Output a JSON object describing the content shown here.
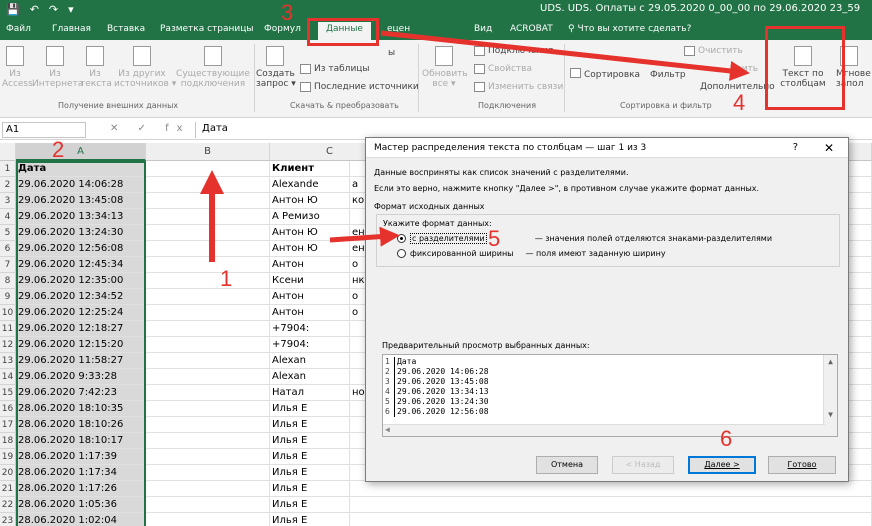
{
  "titlebar": {
    "quick_access": [
      "💾",
      "↶",
      "↷",
      "▾"
    ],
    "doc_title": "UDS. UDS. Оплаты с 29.05.2020 0_00_00 по 29.06.2020 23_59"
  },
  "tabs": [
    {
      "label": "Файл"
    },
    {
      "label": "Главная"
    },
    {
      "label": "Вставка"
    },
    {
      "label": "Разметка страницы"
    },
    {
      "label": "Формул"
    },
    {
      "label": "Данные"
    },
    {
      "label": "ецен"
    },
    {
      "label": "Вид"
    },
    {
      "label": "ACROBAT"
    }
  ],
  "tell_me": "Что вы хотите сделать?",
  "ribbon": {
    "external": {
      "b1": [
        "Из",
        "Access"
      ],
      "b2": [
        "Из",
        "Интернета"
      ],
      "b3": [
        "Из",
        "текста"
      ],
      "b4": [
        "Из других",
        "источников ▾"
      ],
      "b5": [
        "Существующие",
        "подключения"
      ],
      "group": "Получение внешних данных"
    },
    "transform": {
      "new_query": [
        "Создать",
        "запрос ▾"
      ],
      "show_queries": "ы",
      "from_table": "Из таблицы",
      "recent": "Последние источники",
      "group": "Скачать & преобразовать"
    },
    "connections": {
      "refresh": [
        "Обновить",
        "все ▾"
      ],
      "connections": "Подключения",
      "properties": "Свойства",
      "edit_links": "Изменить связи",
      "group": "Подключения"
    },
    "sort": {
      "sort": "Сортировка",
      "filter": "Фильтр",
      "clear": "Очистить",
      "reapply": "рить",
      "advanced": "Дополнительно",
      "group": "Сортировка и фильтр"
    },
    "text_to_columns": [
      "Текст по",
      "столбцам"
    ],
    "next_btn": [
      "Мгнове",
      "запол"
    ]
  },
  "formula_bar": {
    "name_box": "A1",
    "fx": "✕ ✓ fx",
    "value": "Дата"
  },
  "grid": {
    "columns": [
      "A",
      "B",
      "C"
    ],
    "rows": [
      {
        "n": "1",
        "a": "Дата",
        "b": "",
        "c": "Клиент",
        "rest": ""
      },
      {
        "n": "2",
        "a": "29.06.2020 14:06:28",
        "b": "",
        "c": "Alexande",
        "rest": "a"
      },
      {
        "n": "3",
        "a": "29.06.2020 13:45:08",
        "b": "",
        "c": "Антон Ю",
        "rest": "ко"
      },
      {
        "n": "4",
        "a": "29.06.2020 13:34:13",
        "b": "",
        "c": "А Ремизо",
        "rest": ""
      },
      {
        "n": "5",
        "a": "29.06.2020 13:24:30",
        "b": "",
        "c": "Антон Ю",
        "rest": "енко"
      },
      {
        "n": "6",
        "a": "29.06.2020 12:56:08",
        "b": "",
        "c": "Антон Ю",
        "rest": "енко"
      },
      {
        "n": "7",
        "a": "29.06.2020 12:45:34",
        "b": "",
        "c": "Антон",
        "rest": "о"
      },
      {
        "n": "8",
        "a": "29.06.2020 12:35:00",
        "b": "",
        "c": "Ксени",
        "rest": "нко"
      },
      {
        "n": "9",
        "a": "29.06.2020 12:34:52",
        "b": "",
        "c": "Антон",
        "rest": "о"
      },
      {
        "n": "10",
        "a": "29.06.2020 12:25:24",
        "b": "",
        "c": "Антон",
        "rest": "о"
      },
      {
        "n": "11",
        "a": "29.06.2020 12:18:27",
        "b": "",
        "c": "+7904:",
        "rest": ""
      },
      {
        "n": "12",
        "a": "29.06.2020 12:15:20",
        "b": "",
        "c": "+7904:",
        "rest": ""
      },
      {
        "n": "13",
        "a": "29.06.2020 11:58:27",
        "b": "",
        "c": "Alexan",
        "rest": ""
      },
      {
        "n": "14",
        "a": "29.06.2020 9:33:28",
        "b": "",
        "c": "Alexan",
        "rest": ""
      },
      {
        "n": "15",
        "a": "29.06.2020 7:42:23",
        "b": "",
        "c": "Натал",
        "rest": "нова"
      },
      {
        "n": "16",
        "a": "28.06.2020 18:10:35",
        "b": "",
        "c": "Илья Е",
        "rest": ""
      },
      {
        "n": "17",
        "a": "28.06.2020 18:10:26",
        "b": "",
        "c": "Илья Е",
        "rest": ""
      },
      {
        "n": "18",
        "a": "28.06.2020 18:10:17",
        "b": "",
        "c": "Илья Е",
        "rest": ""
      },
      {
        "n": "19",
        "a": "28.06.2020 1:17:39",
        "b": "",
        "c": "Илья Е",
        "rest": ""
      },
      {
        "n": "20",
        "a": "28.06.2020 1:17:34",
        "b": "",
        "c": "Илья Е",
        "rest": ""
      },
      {
        "n": "21",
        "a": "28.06.2020 1:17:26",
        "b": "",
        "c": "Илья Е",
        "rest": ""
      },
      {
        "n": "22",
        "a": "28.06.2020 1:05:36",
        "b": "",
        "c": "Илья Е",
        "rest": ""
      },
      {
        "n": "23",
        "a": "28.06.2020 1:02:04",
        "b": "",
        "c": "Илья Е",
        "rest": ""
      }
    ]
  },
  "dialog": {
    "title": "Мастер распределения текста по столбцам — шаг 1 из 3",
    "help": "?",
    "close": "✕",
    "line1": "Данные восприняты как список значений с разделителями.",
    "line2": "Если это верно, нажмите кнопку \"Далее >\", в противном случае укажите формат данных.",
    "source_format": "Формат исходных данных",
    "specify": "Укажите формат данных:",
    "opt1_label": "с разделителями",
    "opt1_desc": "— значения полей отделяются знаками-разделителями",
    "opt2_label": "фиксированной ширины",
    "opt2_desc": "— поля имеют заданную ширину",
    "preview_label": "Предварительный просмотр выбранных данных:",
    "preview_lines": [
      {
        "n": "1",
        "t": "Дата"
      },
      {
        "n": "2",
        "t": "29.06.2020 14:06:28"
      },
      {
        "n": "3",
        "t": "29.06.2020 13:45:08"
      },
      {
        "n": "4",
        "t": "29.06.2020 13:34:13"
      },
      {
        "n": "5",
        "t": "29.06.2020 13:24:30"
      },
      {
        "n": "6",
        "t": "29.06.2020 12:56:08"
      }
    ],
    "buttons": {
      "cancel": "Отмена",
      "back": "< Назад",
      "next": "Далее >",
      "finish": "Готово"
    }
  },
  "annotations": {
    "n1": "1",
    "n2": "2",
    "n3": "3",
    "n4": "4",
    "n5": "5",
    "n6": "6",
    "color": "#e5322d"
  },
  "colors": {
    "excel_green": "#217346",
    "ribbon_bg": "#f3f3f3",
    "selection_gray": "#d9d9d9"
  }
}
